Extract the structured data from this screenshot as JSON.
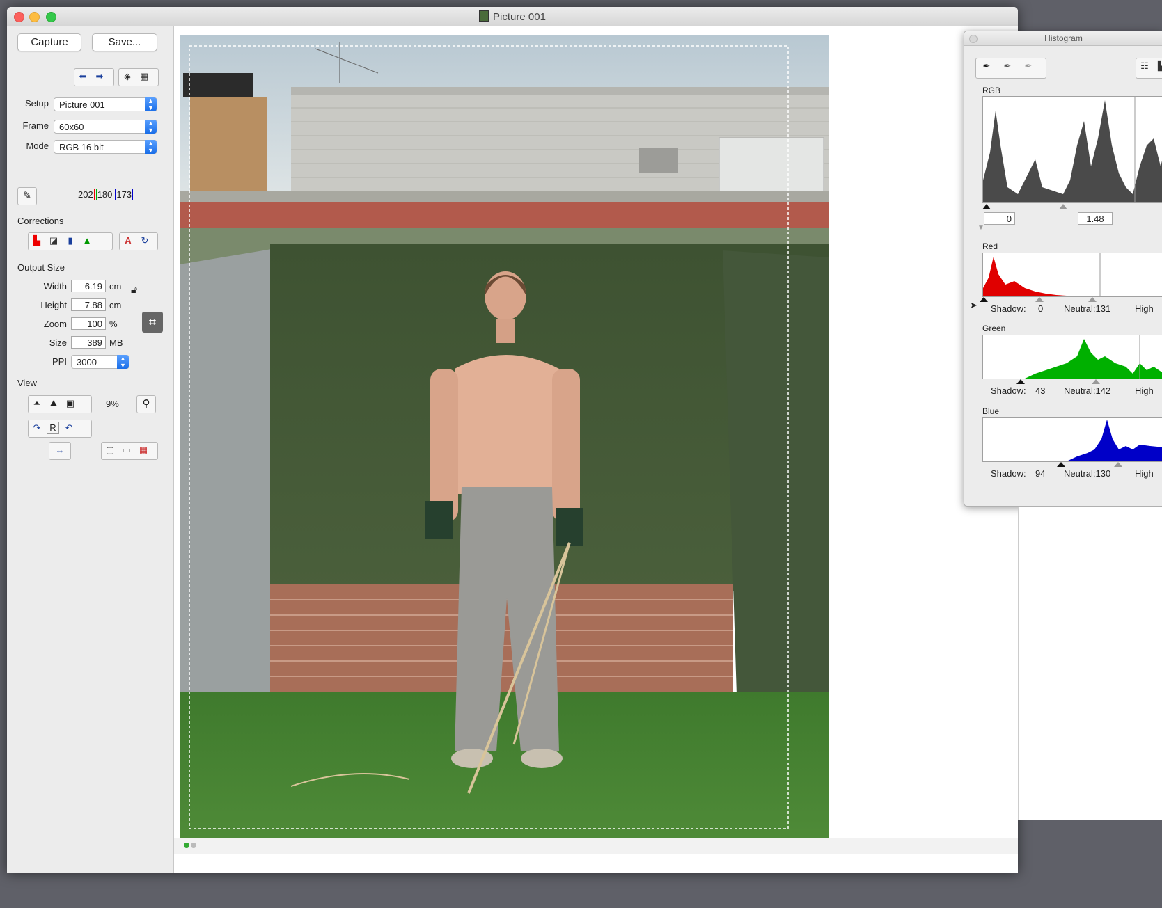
{
  "window": {
    "title": "Picture 001"
  },
  "toolbar": {
    "capture_label": "Capture",
    "save_label": "Save..."
  },
  "setup": {
    "setup_label": "Setup",
    "setup_value": "Picture 001",
    "frame_label": "Frame",
    "frame_value": "60x60",
    "mode_label": "Mode",
    "mode_value": "RGB 16 bit"
  },
  "picker": {
    "r": "202",
    "g": "180",
    "b": "173"
  },
  "corrections": {
    "label": "Corrections"
  },
  "output": {
    "label": "Output Size",
    "width_label": "Width",
    "width_value": "6.19",
    "width_unit": "cm",
    "height_label": "Height",
    "height_value": "7.88",
    "height_unit": "cm",
    "zoom_label": "Zoom",
    "zoom_value": "100",
    "zoom_unit": "%",
    "size_label": "Size",
    "size_value": "389",
    "size_unit": "MB",
    "ppi_label": "PPI",
    "ppi_value": "3000"
  },
  "view": {
    "label": "View",
    "zoom_percent": "9%",
    "rotate_reset": "R"
  },
  "histogram": {
    "title": "Histogram",
    "rgb_label": "RGB",
    "rgb_black": "0",
    "rgb_gamma": "1.48",
    "red_label": "Red",
    "red_shadow_label": "Shadow:",
    "red_shadow": "0",
    "red_neutral": "Neutral:131",
    "red_high": "High",
    "green_label": "Green",
    "green_shadow_label": "Shadow:",
    "green_shadow": "43",
    "green_neutral": "Neutral:142",
    "green_high": "High",
    "blue_label": "Blue",
    "blue_shadow_label": "Shadow:",
    "blue_shadow": "94",
    "blue_neutral": "Neutral:130",
    "blue_high": "High"
  },
  "colors": {
    "red": "#e00000",
    "green": "#00b000",
    "blue": "#0000c8",
    "rgb": "#555555",
    "accent": "#1a6ee8"
  }
}
